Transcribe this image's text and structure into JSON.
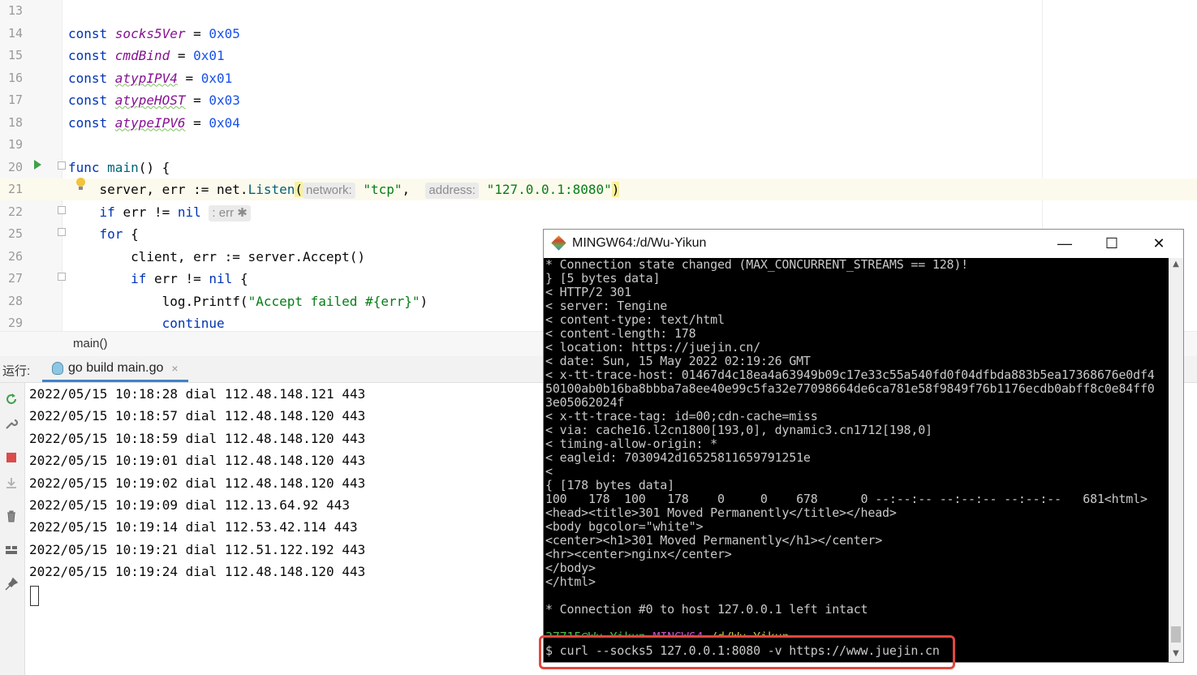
{
  "editor": {
    "lines": [
      {
        "num": "13",
        "parts": []
      },
      {
        "num": "14",
        "parts": [
          {
            "t": "const ",
            "c": "kw"
          },
          {
            "t": "socks5Ver",
            "c": "cn"
          },
          {
            "t": " = ",
            "c": ""
          },
          {
            "t": "0x05",
            "c": "num"
          }
        ]
      },
      {
        "num": "15",
        "parts": [
          {
            "t": "const ",
            "c": "kw"
          },
          {
            "t": "cmdBind",
            "c": "cn"
          },
          {
            "t": " = ",
            "c": ""
          },
          {
            "t": "0x01",
            "c": "num"
          }
        ]
      },
      {
        "num": "16",
        "parts": [
          {
            "t": "const ",
            "c": "kw"
          },
          {
            "t": "atypIPV4",
            "c": "cn ul"
          },
          {
            "t": " = ",
            "c": ""
          },
          {
            "t": "0x01",
            "c": "num"
          }
        ]
      },
      {
        "num": "17",
        "parts": [
          {
            "t": "const ",
            "c": "kw"
          },
          {
            "t": "atypeHOST",
            "c": "cn ul"
          },
          {
            "t": " = ",
            "c": ""
          },
          {
            "t": "0x03",
            "c": "num"
          }
        ]
      },
      {
        "num": "18",
        "parts": [
          {
            "t": "const ",
            "c": "kw"
          },
          {
            "t": "atypeIPV6",
            "c": "cn ul"
          },
          {
            "t": " = ",
            "c": ""
          },
          {
            "t": "0x04",
            "c": "num"
          }
        ]
      },
      {
        "num": "19",
        "parts": []
      },
      {
        "num": "20",
        "parts": [
          {
            "t": "func ",
            "c": "kw"
          },
          {
            "t": "main",
            "c": "fn"
          },
          {
            "t": "() {",
            "c": ""
          }
        ]
      },
      {
        "num": "21",
        "parts": [
          {
            "t": "    server, err := net.",
            "c": ""
          },
          {
            "t": "Listen",
            "c": "fn"
          },
          {
            "t": "(",
            "c": "paren-hl"
          },
          {
            "t": "network:",
            "c": "hint"
          },
          {
            "t": " ",
            "c": ""
          },
          {
            "t": "\"tcp\"",
            "c": "str"
          },
          {
            "t": ",  ",
            "c": ""
          },
          {
            "t": "address:",
            "c": "hint"
          },
          {
            "t": " ",
            "c": ""
          },
          {
            "t": "\"127.0.0.1:8080\"",
            "c": "str"
          },
          {
            "t": ")",
            "c": "paren-hl"
          }
        ]
      },
      {
        "num": "22",
        "parts": [
          {
            "t": "    ",
            "c": ""
          },
          {
            "t": "if ",
            "c": "kw"
          },
          {
            "t": "err != ",
            "c": ""
          },
          {
            "t": "nil",
            "c": "kw"
          },
          {
            "t": " ",
            "c": ""
          },
          {
            "t": ": err ✱",
            "c": "hint"
          }
        ]
      },
      {
        "num": "25",
        "parts": [
          {
            "t": "    ",
            "c": ""
          },
          {
            "t": "for ",
            "c": "kw"
          },
          {
            "t": "{",
            "c": ""
          }
        ]
      },
      {
        "num": "26",
        "parts": [
          {
            "t": "        client, err := server.Accept()",
            "c": ""
          }
        ]
      },
      {
        "num": "27",
        "parts": [
          {
            "t": "        ",
            "c": ""
          },
          {
            "t": "if ",
            "c": "kw"
          },
          {
            "t": "err != ",
            "c": ""
          },
          {
            "t": "nil",
            "c": "kw"
          },
          {
            "t": " {",
            "c": ""
          }
        ]
      },
      {
        "num": "28",
        "parts": [
          {
            "t": "            log.Printf(",
            "c": ""
          },
          {
            "t": "\"Accept failed #{err}\"",
            "c": "str"
          },
          {
            "t": ")",
            "c": ""
          }
        ]
      },
      {
        "num": "29",
        "parts": [
          {
            "t": "            ",
            "c": ""
          },
          {
            "t": "continue",
            "c": "kw"
          }
        ]
      }
    ],
    "breadcrumb": "main()"
  },
  "run_panel": {
    "label": "运行:",
    "tab_label": "go build main.go",
    "tab_close": "×",
    "log_lines": [
      "2022/05/15 10:18:28 dial 112.48.148.121 443",
      "2022/05/15 10:18:57 dial 112.48.148.120 443",
      "2022/05/15 10:18:59 dial 112.48.148.120 443",
      "2022/05/15 10:19:01 dial 112.48.148.120 443",
      "2022/05/15 10:19:02 dial 112.48.148.120 443",
      "2022/05/15 10:19:09 dial 112.13.64.92 443",
      "2022/05/15 10:19:14 dial 112.53.42.114 443",
      "2022/05/15 10:19:21 dial 112.51.122.192 443",
      "2022/05/15 10:19:24 dial 112.48.148.120 443"
    ],
    "toolbar_icons": [
      "rerun-icon",
      "wrench-icon",
      "stop-icon",
      "import-icon",
      "trash-icon",
      "layout-icon",
      "pin-icon"
    ]
  },
  "terminal": {
    "title": "MINGW64:/d/Wu-Yikun",
    "lines": [
      {
        "t": "* Connection state changed (MAX_CONCURRENT_STREAMS == 128)!"
      },
      {
        "t": "} [5 bytes data]"
      },
      {
        "t": "< HTTP/2 301"
      },
      {
        "t": "< server: Tengine"
      },
      {
        "t": "< content-type: text/html"
      },
      {
        "t": "< content-length: 178"
      },
      {
        "t": "< location: https://juejin.cn/"
      },
      {
        "t": "< date: Sun, 15 May 2022 02:19:26 GMT"
      },
      {
        "t": "< x-tt-trace-host: 01467d4c18ea4a63949b09c17e33c55a540fd0f04dfbda883b5ea17368676e0df4"
      },
      {
        "t": "50100ab0b16ba8bbba7a8ee40e99c5fa32e77098664de6ca781e58f9849f76b1176ecdb0abff8c0e84ff0"
      },
      {
        "t": "3e05062024f"
      },
      {
        "t": "< x-tt-trace-tag: id=00;cdn-cache=miss"
      },
      {
        "t": "< via: cache16.l2cn1800[193,0], dynamic3.cn1712[198,0]"
      },
      {
        "t": "< timing-allow-origin: *"
      },
      {
        "t": "< eagleid: 7030942d16525811659791251e"
      },
      {
        "t": "<"
      },
      {
        "t": "{ [178 bytes data]"
      },
      {
        "t": "100   178  100   178    0     0    678      0 --:--:-- --:--:-- --:--:--   681<html>"
      },
      {
        "t": "<head><title>301 Moved Permanently</title></head>"
      },
      {
        "t": "<body bgcolor=\"white\">"
      },
      {
        "t": "<center><h1>301 Moved Permanently</h1></center>"
      },
      {
        "t": "<hr><center>nginx</center>"
      },
      {
        "t": "</body>"
      },
      {
        "t": "</html>"
      },
      {
        "t": ""
      },
      {
        "t": "* Connection #0 to host 127.0.0.1 left intact"
      },
      {
        "t": ""
      }
    ],
    "prompt_user": "37715@Wu-Yikun",
    "prompt_env": "MINGW64",
    "prompt_path": "/d/Wu-Yikun",
    "command": "$ curl --socks5 127.0.0.1:8080 -v https://www.juejin.cn",
    "minimize": "—",
    "maximize": "☐",
    "close": "✕"
  },
  "colors": {
    "accent": "#4083c9",
    "highlight_box": "#e0483e",
    "terminal_bg": "#000000",
    "prompt_user": "#4cbe4c",
    "prompt_env": "#c050c0",
    "prompt_path": "#c8b850"
  }
}
